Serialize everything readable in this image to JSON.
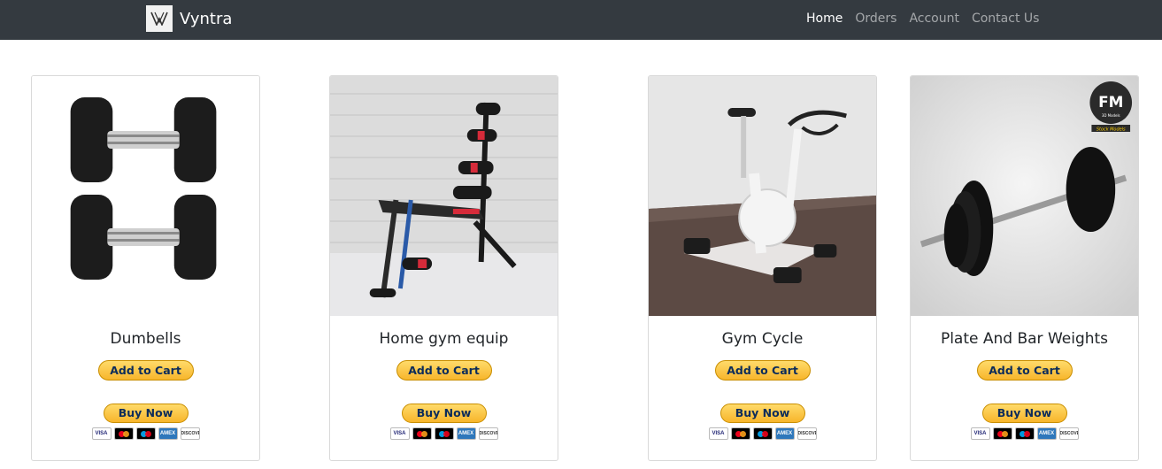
{
  "navbar": {
    "brand": "Vyntra",
    "links": [
      {
        "label": "Home",
        "active": true
      },
      {
        "label": "Orders",
        "active": false
      },
      {
        "label": "Account",
        "active": false
      },
      {
        "label": "Contact Us",
        "active": false
      }
    ]
  },
  "products": [
    {
      "title": "Dumbells",
      "image_icon": "dumbbells-image",
      "add_to_cart": "Add to Cart",
      "buy_now": "Buy Now"
    },
    {
      "title": "Home gym equip",
      "image_icon": "home-gym-bench-image",
      "add_to_cart": "Add to Cart",
      "buy_now": "Buy Now"
    },
    {
      "title": "Gym Cycle",
      "image_icon": "exercise-bike-image",
      "add_to_cart": "Add to Cart",
      "buy_now": "Buy Now"
    },
    {
      "title": "Plate And Bar Weights",
      "image_icon": "barbell-image",
      "add_to_cart": "Add to Cart",
      "buy_now": "Buy Now"
    }
  ],
  "payment_marks": [
    "VISA",
    "mastercard",
    "maestro",
    "AMEX",
    "DISCOVER"
  ],
  "watermark": {
    "logo": "FM",
    "line1": "3D Models",
    "line2": "Stock Models"
  },
  "colors": {
    "navbar": "#343a40",
    "paypal_button": "#ffc439",
    "text": "#212529"
  }
}
